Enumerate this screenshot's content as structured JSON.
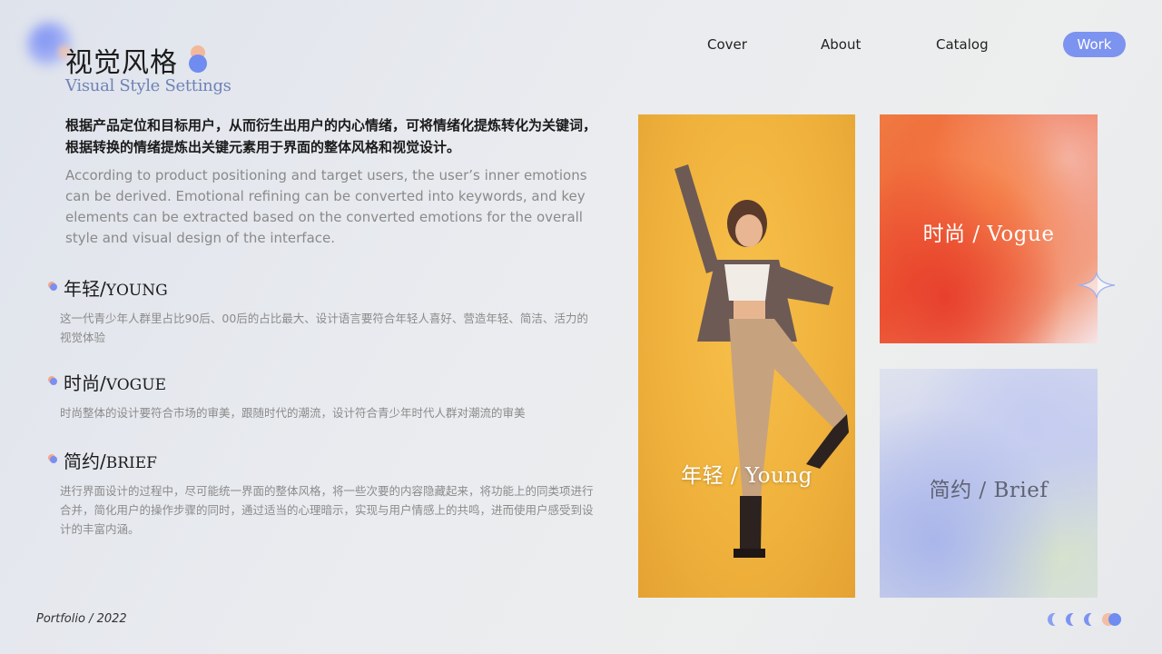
{
  "header": {
    "title_cn": "视觉风格",
    "title_en": "Visual Style Settings"
  },
  "nav": {
    "cover": "Cover",
    "about": "About",
    "catalog": "Catalog",
    "work": "Work"
  },
  "intro": {
    "cn": "根据产品定位和目标用户，从而衍生出用户的内心情绪，可将情绪化提炼转化为关键词，根据转换的情绪提炼出关键元素用于界面的整体风格和视觉设计。",
    "en": "According to product positioning and target users, the user’s inner emotions  can be derived. Emotional refining can be converted into keywords, and key elements can be extracted based on the converted emotions for the overall style and visual design of the interface."
  },
  "sections": [
    {
      "title_cn": "年轻/",
      "title_en": "YOUNG",
      "body": "这一代青少年人群里占比90后、00后的占比最大、设计语言要符合年轻人喜好、营造年轻、简洁、活力的视觉体验"
    },
    {
      "title_cn": "时尚/",
      "title_en": "VOGUE",
      "body": "时尚整体的设计要符合市场的审美，跟随时代的潮流，设计符合青少年时代人群对潮流的审美"
    },
    {
      "title_cn": "简约/",
      "title_en": "BRIEF",
      "body": "进行界面设计的过程中，尽可能统一界面的整体风格，将一些次要的内容隐藏起来，将功能上的同类项进行合并，简化用户的操作步骤的同时，通过适当的心理暗示，实现与用户情感上的共鸣，进而使用户感受到设计的丰富内涵。"
    }
  ],
  "cards": {
    "young": "年轻 / Young",
    "vogue": "时尚 / Vogue",
    "brief": "简约 / Brief"
  },
  "footer": {
    "text": "Portfolio / 2022"
  },
  "colors": {
    "accent": "#7c93f0",
    "peach": "#f2b89a",
    "yellow": "#efb13c",
    "orange": "#ef5b34"
  }
}
